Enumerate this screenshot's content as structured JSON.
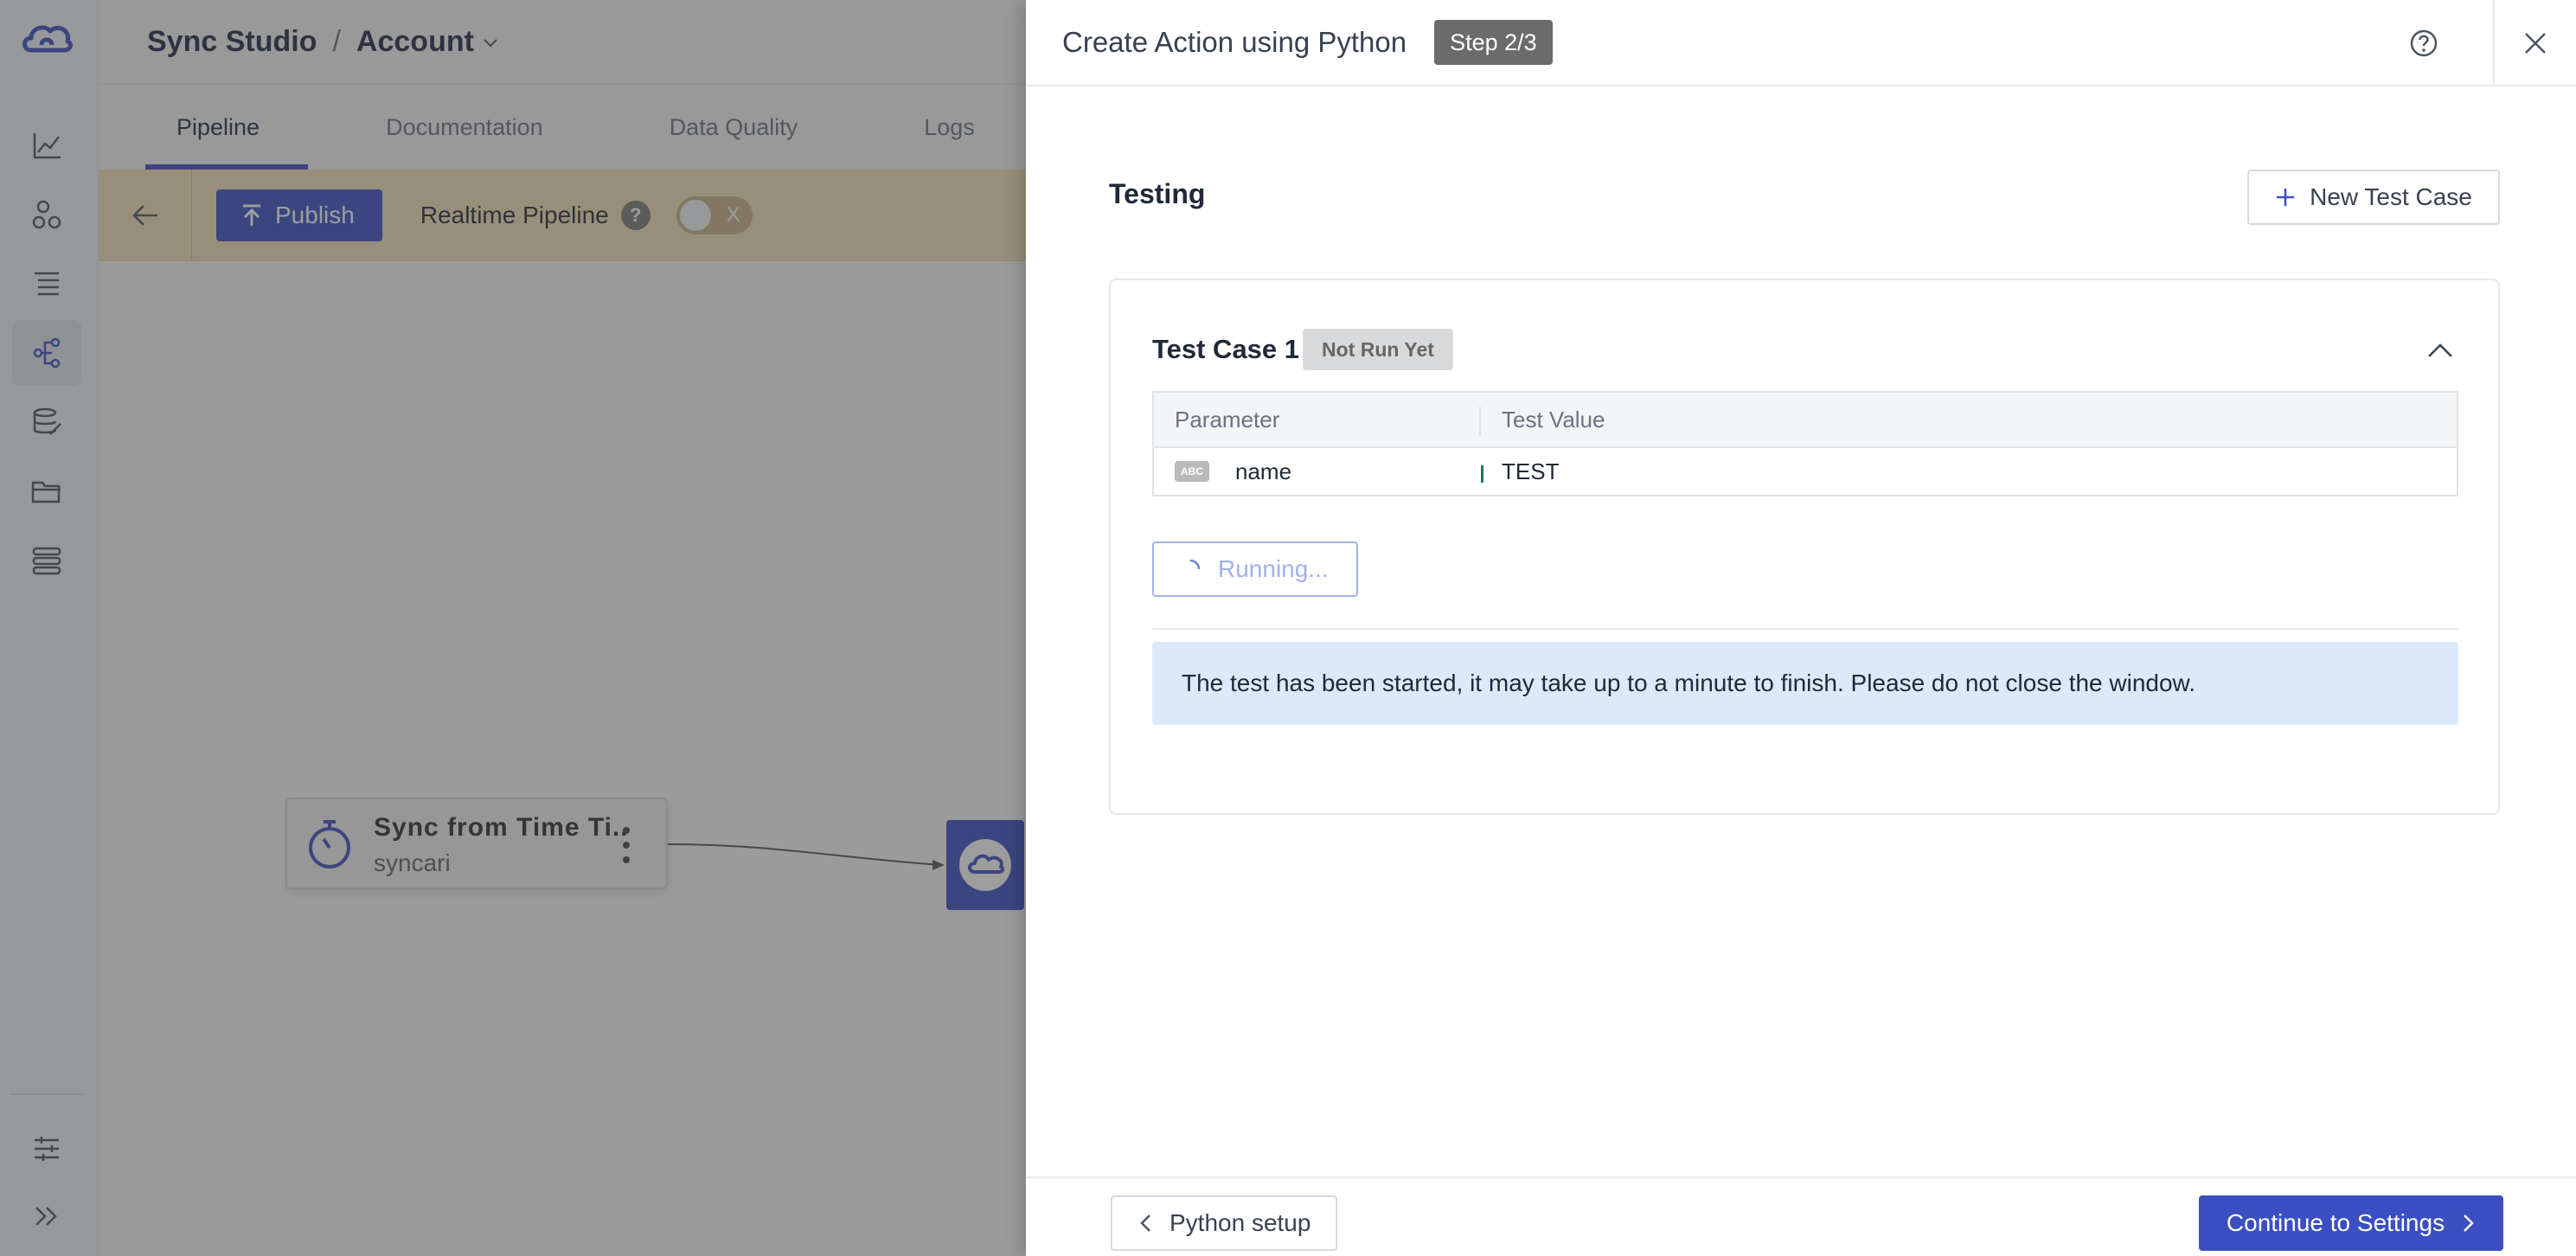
{
  "app": {
    "breadcrumb": [
      "Sync Studio",
      "Account"
    ],
    "breadcrumb_separator": "/",
    "tabs": [
      "Pipeline",
      "Documentation",
      "Data Quality",
      "Logs"
    ],
    "active_tab": "Pipeline",
    "toolbar": {
      "publish_label": "Publish",
      "realtime_label": "Realtime Pipeline",
      "help_glyph": "?",
      "toggle_glyph": "X"
    },
    "rail_icons": [
      "syncari-logo-icon",
      "dashboard-chart-icon",
      "entities-icon",
      "list-icon",
      "pipeline-icon",
      "data-edit-icon",
      "folder-icon",
      "stack-icon",
      "settings-sliders-icon",
      "expand-icon"
    ],
    "canvas": {
      "source_node": {
        "title": "Sync from  Time Ti...",
        "subtitle": "syncari"
      }
    }
  },
  "drawer": {
    "title": "Create Action using Python",
    "step": "Step 2/3",
    "section_title": "Testing",
    "new_test_case_label": "New Test Case",
    "test_case": {
      "title": "Test Case 1",
      "status": "Not Run Yet",
      "columns": [
        "Parameter",
        "Test Value"
      ],
      "rows": [
        {
          "type_tag": "ABC",
          "parameter": "name",
          "value": "TEST"
        }
      ],
      "running_label": "Running...",
      "info_message": "The test has been started, it may take up to a minute to finish. Please do not close the window."
    },
    "footer": {
      "back_label": "Python setup",
      "continue_label": "Continue to Settings"
    }
  },
  "colors": {
    "primary": "#3b4fc2",
    "toolbar_bg": "#f5e3b8",
    "info_bg": "#dce9fb",
    "overlay": "rgba(60,60,60,0.5)"
  }
}
